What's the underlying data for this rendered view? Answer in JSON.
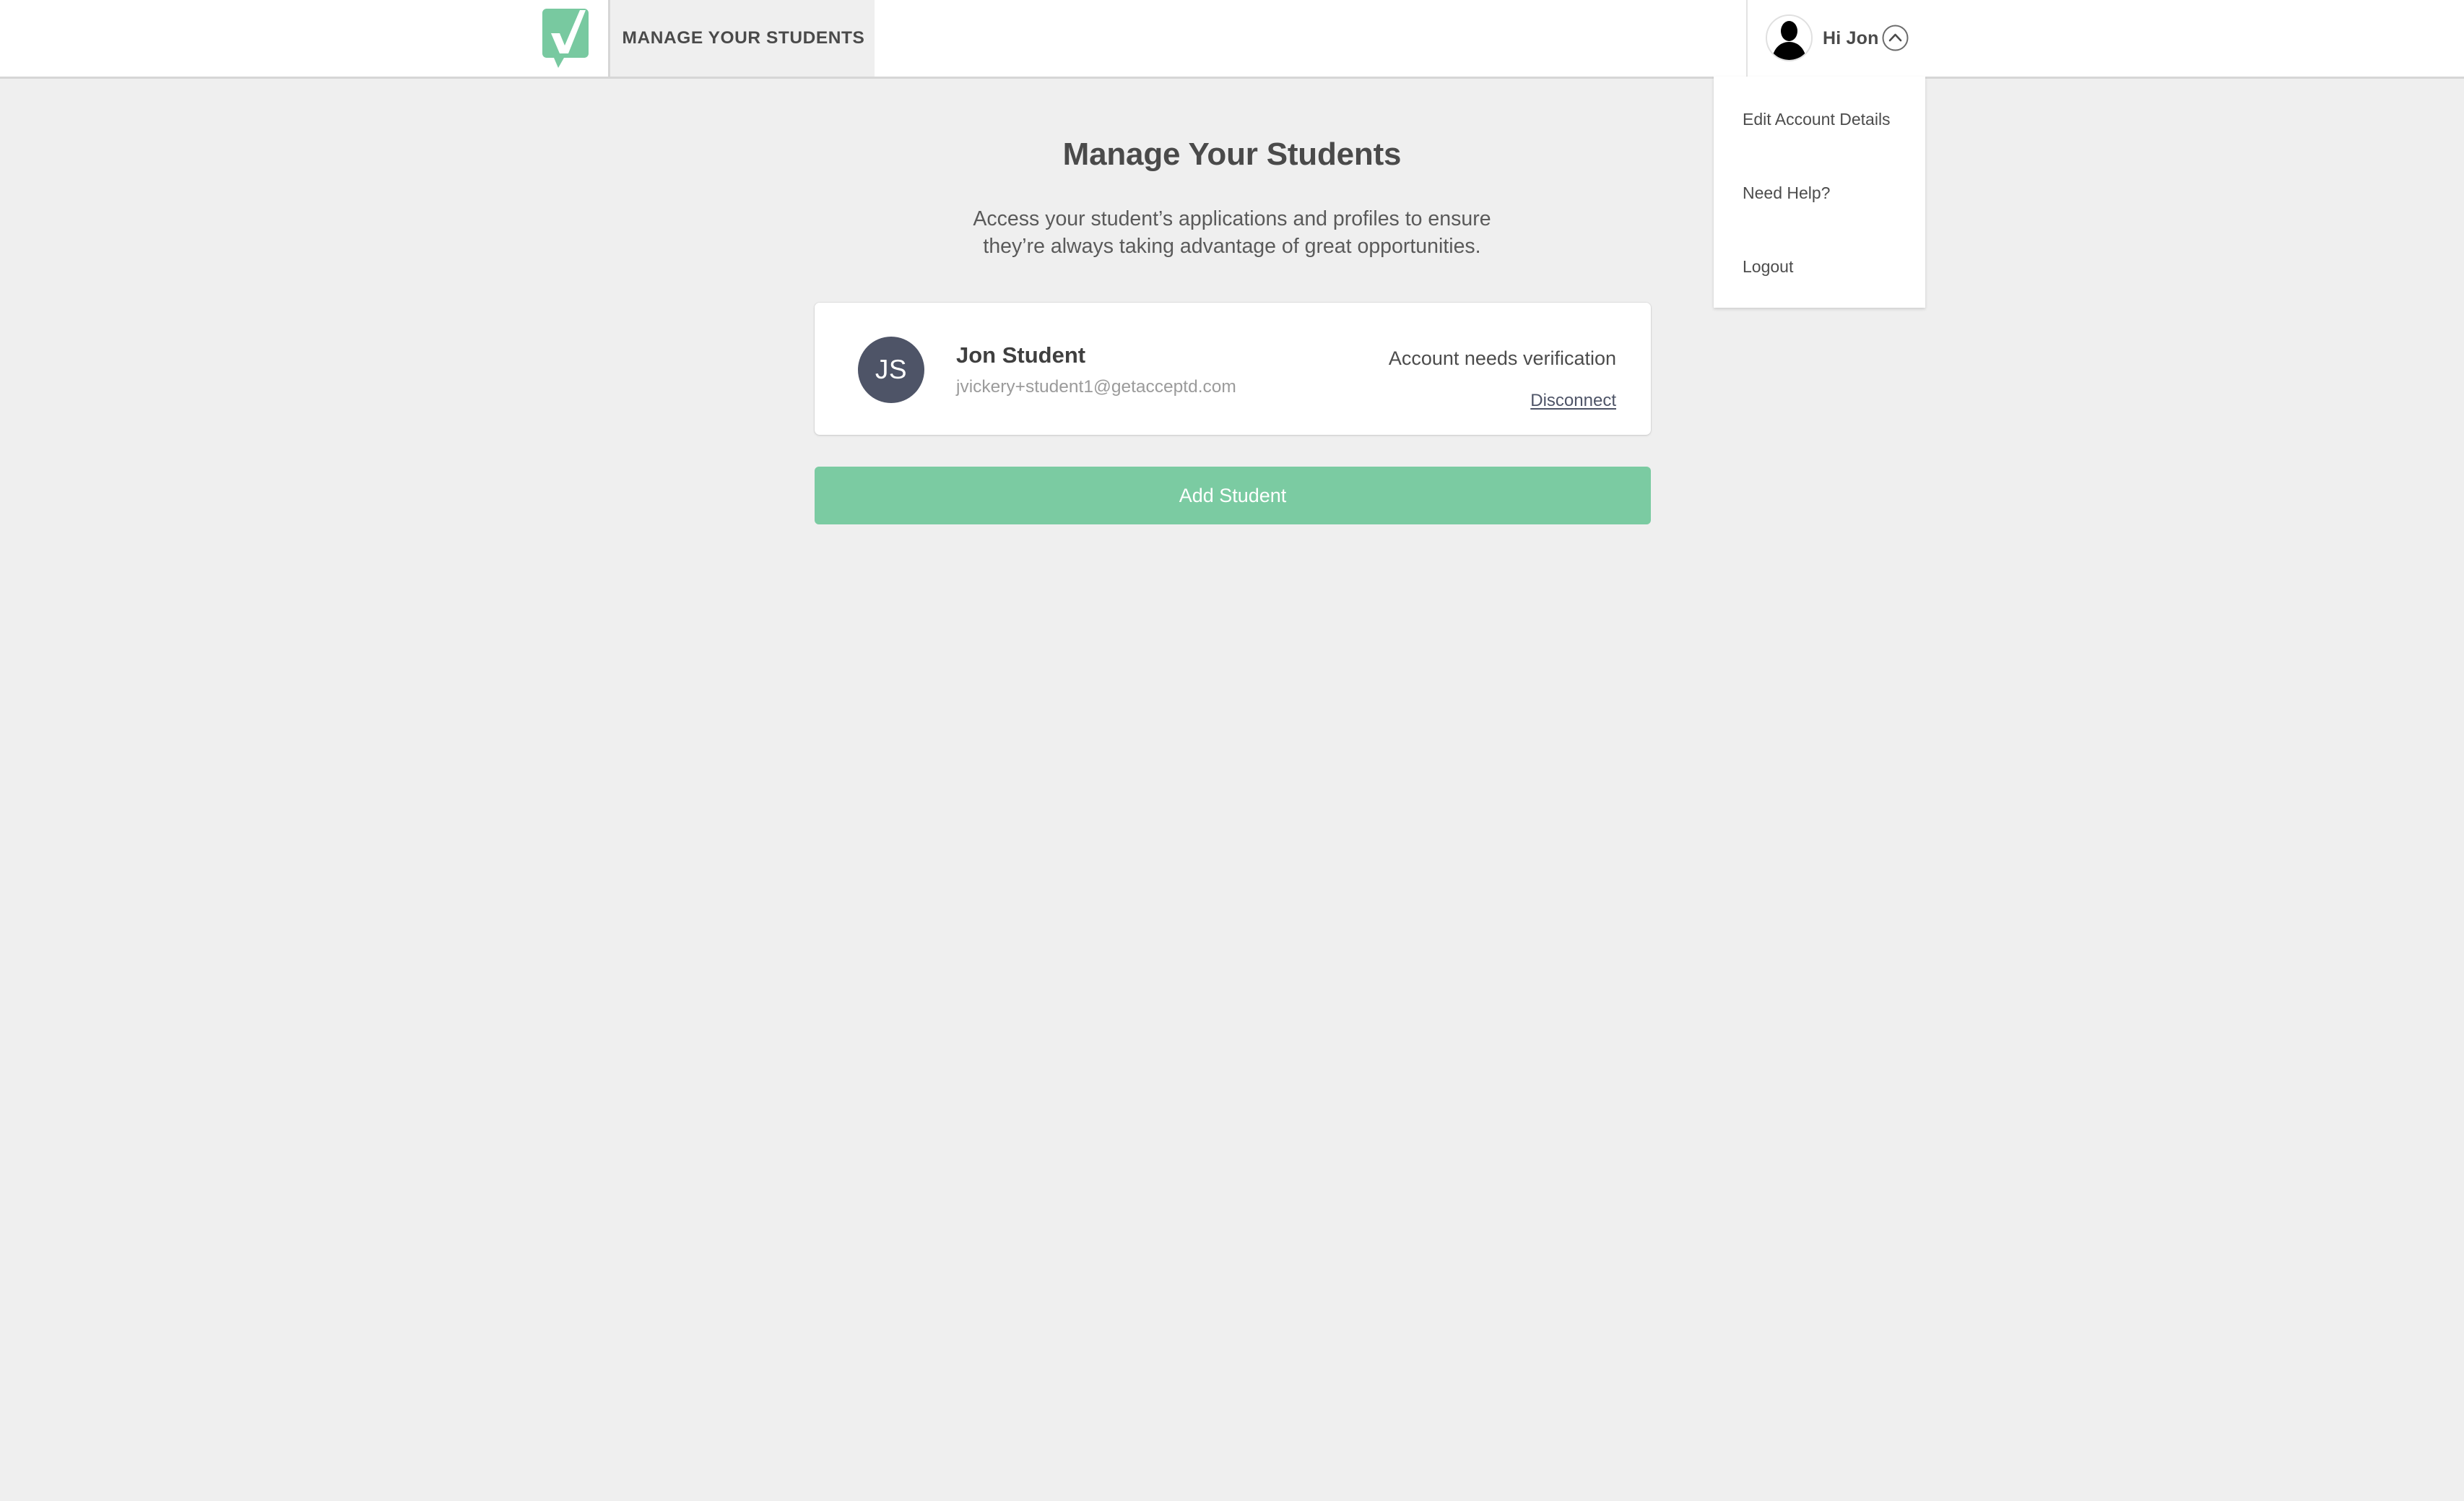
{
  "colors": {
    "page_background": "#efefef",
    "brand_green": "#7bcba2",
    "header_white": "#ffffff",
    "title_text": "#4a4a4a",
    "avatar_slate": "#4e5467",
    "muted_text": "#9b9b9b",
    "divider": "#d6d6d6"
  },
  "header": {
    "logo_icon": "green-check-badge-icon",
    "active_tab_label": "MANAGE YOUR STUDENTS",
    "user": {
      "avatar_icon": "user-silhouette-avatar-icon",
      "greeting": "Hi Jon",
      "chevron_icon": "chevron-up-circle-icon",
      "menu_expanded": true
    }
  },
  "dropdown": {
    "items": [
      {
        "label": "Edit Account Details",
        "name": "edit-account-details"
      },
      {
        "label": "Need Help?",
        "name": "need-help"
      },
      {
        "label": "Logout",
        "name": "logout"
      }
    ]
  },
  "main": {
    "title": "Manage Your Students",
    "subtitle_line1": "Access your student’s applications and profiles to ensure",
    "subtitle_line2": "they’re always taking advantage of great opportunities.",
    "students": [
      {
        "initials": "JS",
        "name": "Jon Student",
        "email": "jvickery+student1@getacceptd.com",
        "status": "Account needs verification",
        "disconnect_label": "Disconnect"
      }
    ],
    "add_student_label": "Add Student"
  }
}
